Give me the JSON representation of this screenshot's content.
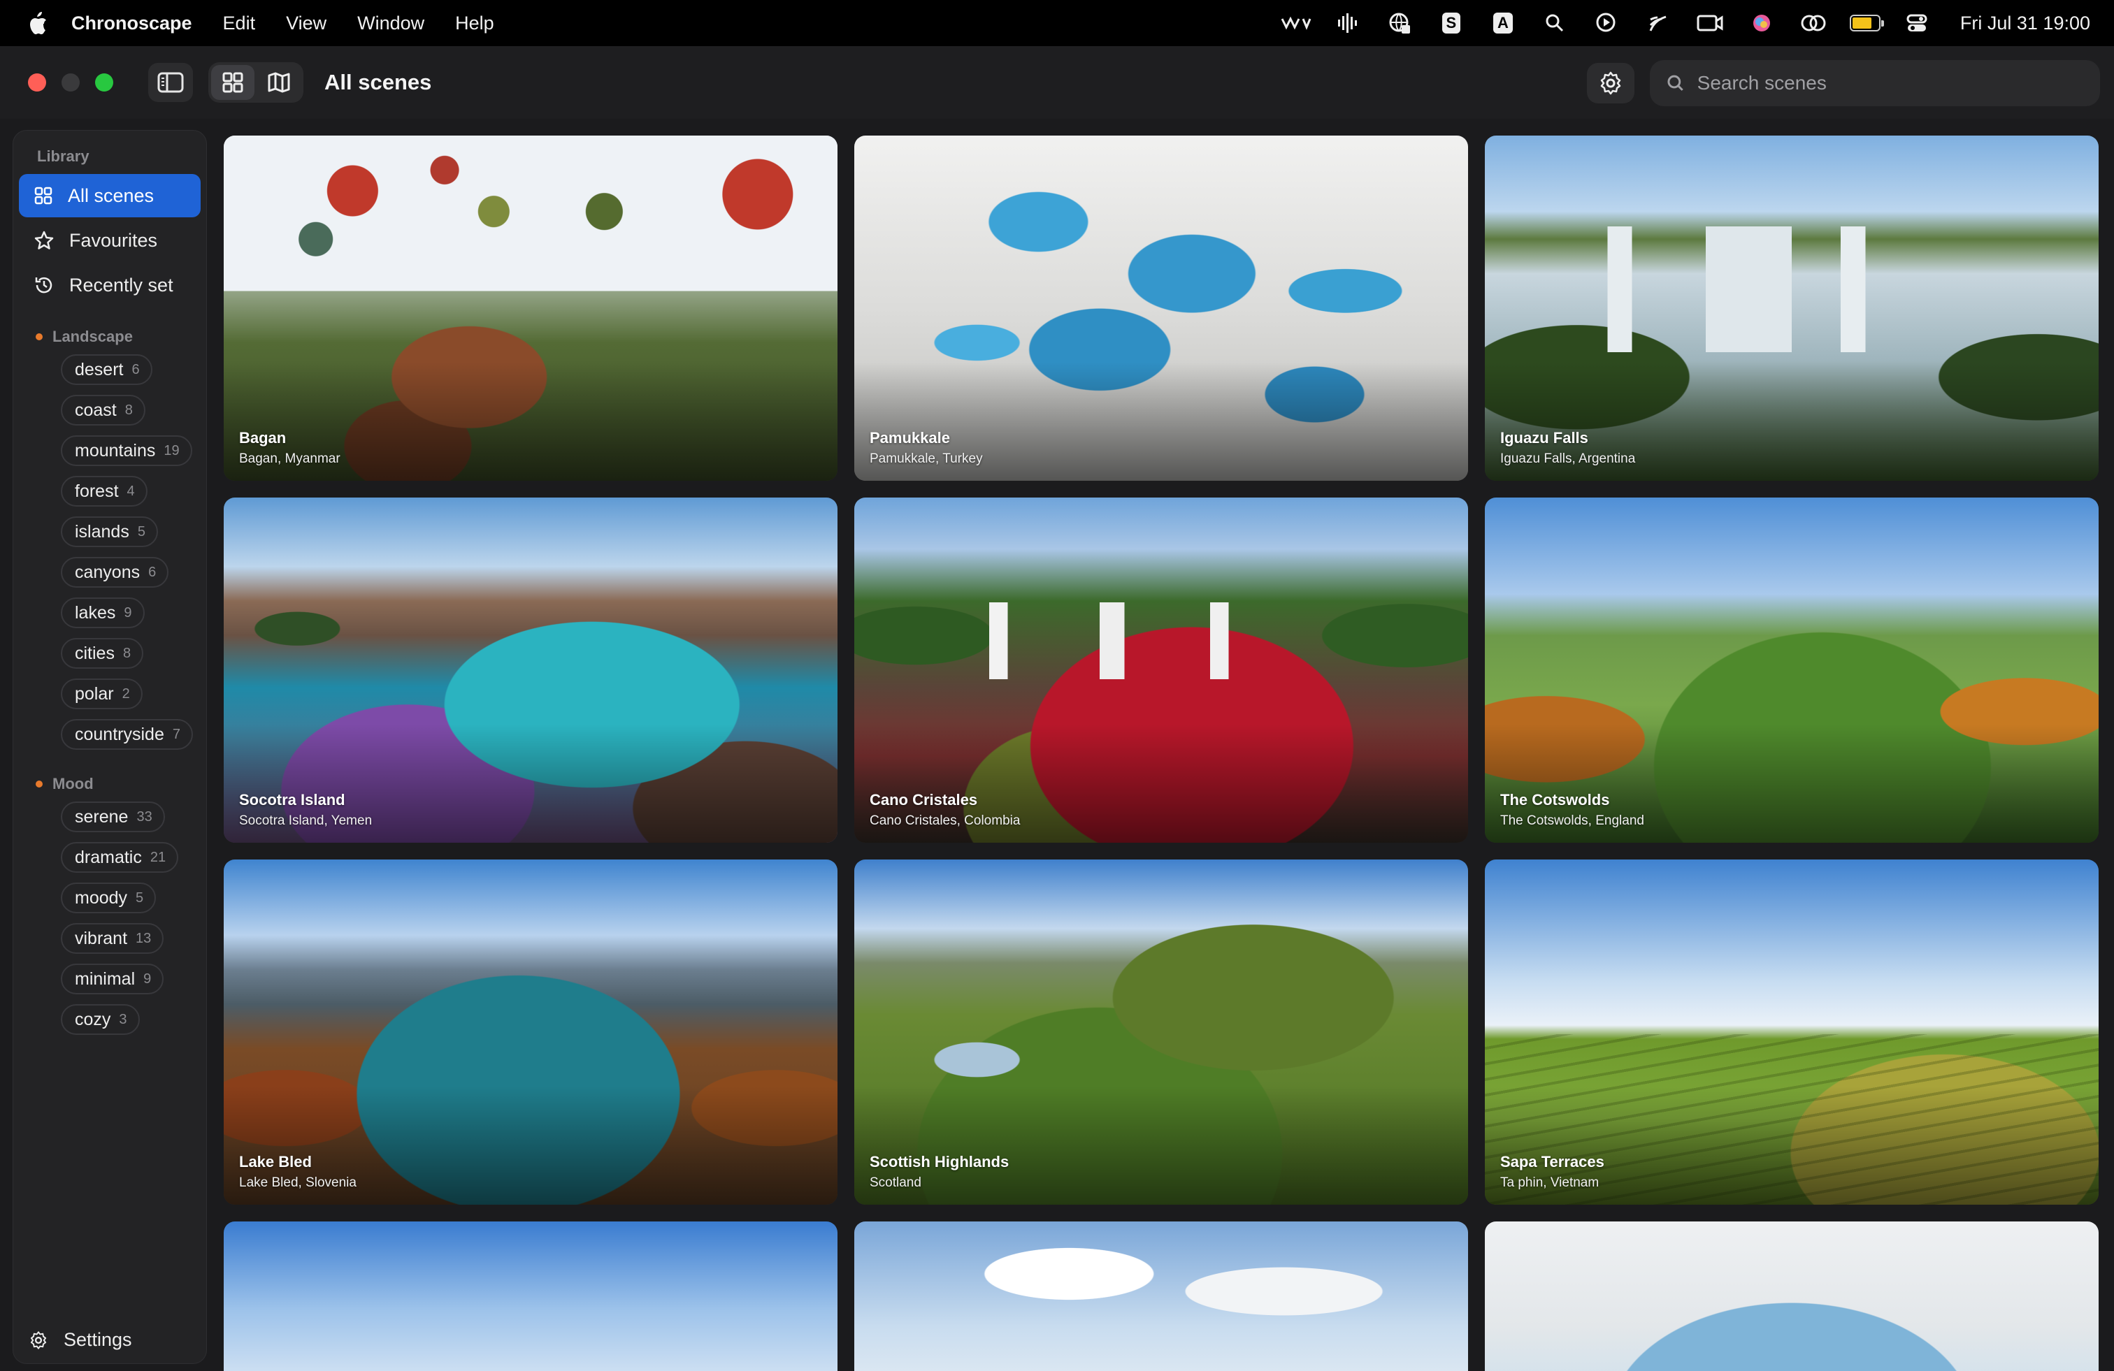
{
  "menubar": {
    "app_name": "Chronoscape",
    "menus": [
      "Edit",
      "View",
      "Window",
      "Help"
    ],
    "status_letters": {
      "s": "S",
      "a": "A"
    },
    "battery_level": 0.75,
    "clock": "Fri Jul 31  19:00"
  },
  "toolbar": {
    "title": "All scenes",
    "search_placeholder": "Search scenes"
  },
  "sidebar": {
    "library_label": "Library",
    "library": [
      {
        "label": "All scenes",
        "icon": "grid-icon",
        "active": true
      },
      {
        "label": "Favourites",
        "icon": "star-icon"
      },
      {
        "label": "Recently set",
        "icon": "history-icon"
      }
    ],
    "landscape_label": "Landscape",
    "landscape": [
      {
        "label": "desert",
        "count": "6"
      },
      {
        "label": "coast",
        "count": "8"
      },
      {
        "label": "mountains",
        "count": "19"
      },
      {
        "label": "forest",
        "count": "4"
      },
      {
        "label": "islands",
        "count": "5"
      },
      {
        "label": "canyons",
        "count": "6"
      },
      {
        "label": "lakes",
        "count": "9"
      },
      {
        "label": "cities",
        "count": "8"
      },
      {
        "label": "polar",
        "count": "2"
      },
      {
        "label": "countryside",
        "count": "7"
      }
    ],
    "mood_label": "Mood",
    "mood": [
      {
        "label": "serene",
        "count": "33"
      },
      {
        "label": "dramatic",
        "count": "21"
      },
      {
        "label": "moody",
        "count": "5"
      },
      {
        "label": "vibrant",
        "count": "13"
      },
      {
        "label": "minimal",
        "count": "9"
      },
      {
        "label": "cozy",
        "count": "3"
      }
    ],
    "settings_label": "Settings"
  },
  "scenes": [
    {
      "name": "Bagan",
      "location": "Bagan, Myanmar"
    },
    {
      "name": "Pamukkale",
      "location": "Pamukkale, Turkey"
    },
    {
      "name": "Iguazu Falls",
      "location": "Iguazu Falls, Argentina"
    },
    {
      "name": "Socotra Island",
      "location": "Socotra Island, Yemen"
    },
    {
      "name": "Cano Cristales",
      "location": "Cano Cristales, Colombia"
    },
    {
      "name": "The Cotswolds",
      "location": "The Cotswolds, England"
    },
    {
      "name": "Lake Bled",
      "location": "Lake Bled, Slovenia"
    },
    {
      "name": "Scottish Highlands",
      "location": "Scotland"
    },
    {
      "name": "Sapa Terraces",
      "location": "Ta phin, Vietnam"
    }
  ],
  "colors": {
    "accent": "#1f63d6",
    "close": "#ff5f57",
    "maximize": "#28c840",
    "dot": "#e87a2c"
  }
}
